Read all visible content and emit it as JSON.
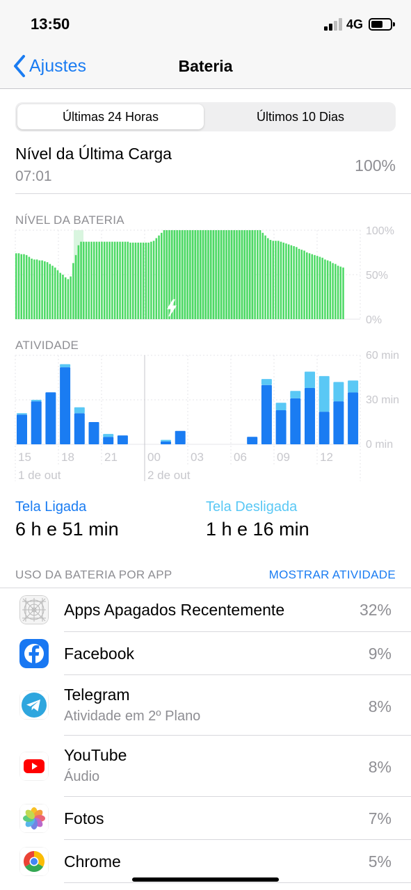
{
  "status_bar": {
    "time": "13:50",
    "network": "4G"
  },
  "nav": {
    "back_label": "Ajustes",
    "title": "Bateria"
  },
  "segmented": {
    "active": "Últimas 24 Horas",
    "inactive": "Últimos 10 Dias"
  },
  "last_charge": {
    "label": "Nível da Última Carga",
    "time": "07:01",
    "value": "100%"
  },
  "battery_level": {
    "label": "NÍVEL DA BATERIA",
    "y_labels": [
      "100%",
      "50%",
      "0%"
    ]
  },
  "activity": {
    "label": "ATIVIDADE",
    "y_labels": [
      "60 min",
      "30 min",
      "0 min"
    ],
    "x_ticks": [
      "15",
      "18",
      "21",
      "00",
      "03",
      "06",
      "09",
      "12"
    ],
    "date_labels": [
      "1 de out",
      "2 de out"
    ]
  },
  "chart_data": [
    {
      "type": "bar",
      "title": "NÍVEL DA BATERIA",
      "ylim": [
        0,
        100
      ],
      "y_ticks": [
        "100%",
        "50%",
        "0%"
      ],
      "charging_segments": [
        "around 18h (1 de out)",
        "around 02h-07h (2 de out)"
      ],
      "values": [
        74,
        74,
        73,
        73,
        72,
        70,
        68,
        67,
        67,
        66,
        66,
        65,
        64,
        62,
        60,
        58,
        55,
        52,
        50,
        47,
        45,
        48,
        63,
        72,
        83,
        87,
        87,
        87,
        87,
        87,
        87,
        87,
        87,
        87,
        87,
        87,
        87,
        87,
        87,
        87,
        87,
        87,
        87,
        87,
        86,
        86,
        86,
        86,
        86,
        86,
        86,
        86,
        87,
        88,
        91,
        94,
        97,
        100,
        100,
        100,
        100,
        100,
        100,
        100,
        100,
        100,
        100,
        100,
        100,
        100,
        100,
        100,
        100,
        100,
        100,
        100,
        100,
        100,
        100,
        100,
        100,
        100,
        100,
        100,
        100,
        100,
        100,
        100,
        100,
        100,
        100,
        100,
        100,
        100,
        100,
        97,
        94,
        91,
        89,
        88,
        88,
        88,
        87,
        86,
        85,
        84,
        83,
        82,
        81,
        79,
        78,
        77,
        75,
        74,
        73,
        72,
        71,
        70,
        69,
        67,
        66,
        65,
        63,
        62,
        60,
        59,
        58
      ]
    },
    {
      "type": "bar",
      "title": "ATIVIDADE",
      "ylim": [
        0,
        60
      ],
      "x_ticks": [
        "15",
        "18",
        "21",
        "00",
        "03",
        "06",
        "09",
        "12"
      ],
      "series": [
        {
          "name": "Tela Ligada",
          "values": [
            20,
            29,
            35,
            52,
            21,
            15,
            5,
            6,
            0,
            0,
            2,
            9,
            0,
            0,
            0,
            0,
            5,
            40,
            23,
            31,
            38,
            22,
            29,
            35
          ]
        },
        {
          "name": "Tela Desligada",
          "values": [
            1,
            1,
            0,
            2,
            4,
            0,
            2,
            0,
            0,
            0,
            1,
            0,
            0,
            0,
            0,
            0,
            0,
            4,
            5,
            5,
            11,
            24,
            13,
            8
          ]
        }
      ]
    }
  ],
  "screen_on": {
    "label": "Tela Ligada",
    "value": "6 h e 51 min"
  },
  "screen_off": {
    "label": "Tela Desligada",
    "value": "1 h e 16 min"
  },
  "usage": {
    "label": "USO DA BATERIA POR APP",
    "link": "MOSTRAR ATIVIDADE",
    "apps": [
      {
        "name": "Apps Apagados Recentemente",
        "sub": "",
        "pct": "32%",
        "icon": "deleted-apps-icon"
      },
      {
        "name": "Facebook",
        "sub": "",
        "pct": "9%",
        "icon": "facebook-icon"
      },
      {
        "name": "Telegram",
        "sub": "Atividade em 2º Plano",
        "pct": "8%",
        "icon": "telegram-icon"
      },
      {
        "name": "YouTube",
        "sub": "Áudio",
        "pct": "8%",
        "icon": "youtube-icon"
      },
      {
        "name": "Fotos",
        "sub": "",
        "pct": "7%",
        "icon": "photos-icon"
      },
      {
        "name": "Chrome",
        "sub": "",
        "pct": "5%",
        "icon": "chrome-icon"
      }
    ]
  },
  "colors": {
    "accent": "#1a7cf2",
    "battery_green": "#4cd964",
    "screen_on": "#1a7cf2",
    "screen_off": "#5ac8f5"
  }
}
